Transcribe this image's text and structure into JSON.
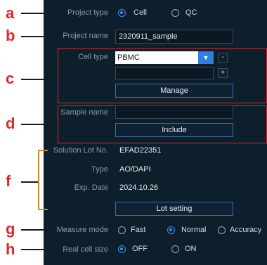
{
  "annotations": [
    "a",
    "b",
    "c",
    "d",
    "f",
    "g",
    "h"
  ],
  "project_type": {
    "label": "Project type",
    "options": [
      "Cell",
      "QC"
    ],
    "selected": "Cell"
  },
  "project_name": {
    "label": "Project name",
    "value": "2320911_sample"
  },
  "cell_type": {
    "label": "Cell type",
    "selected": "PBMC",
    "arrow": "▼",
    "minus": "-",
    "plus": "+",
    "input_value": "",
    "manage_label": "Manage"
  },
  "sample_name": {
    "label": "Sample name",
    "value": "",
    "include_label": "Include"
  },
  "solution": {
    "lot_label": "Solution Lot No.",
    "lot_value": "EFAD22351",
    "type_label": "Type",
    "type_value": "AO/DAPI",
    "exp_label": "Exp. Date",
    "exp_value": "2024.10.26",
    "lot_setting_label": "Lot setting"
  },
  "measure_mode": {
    "label": "Measure mode",
    "options": [
      "Fast",
      "Normal",
      "Accuracy"
    ],
    "selected": "Normal"
  },
  "real_cell_size": {
    "label": "Real cell size",
    "options": [
      "OFF",
      "ON"
    ],
    "selected": "OFF"
  },
  "colors": {
    "panel_bg": "#0e1f2c",
    "accent": "#3d8ef0",
    "annotation_red": "#e0262b"
  }
}
